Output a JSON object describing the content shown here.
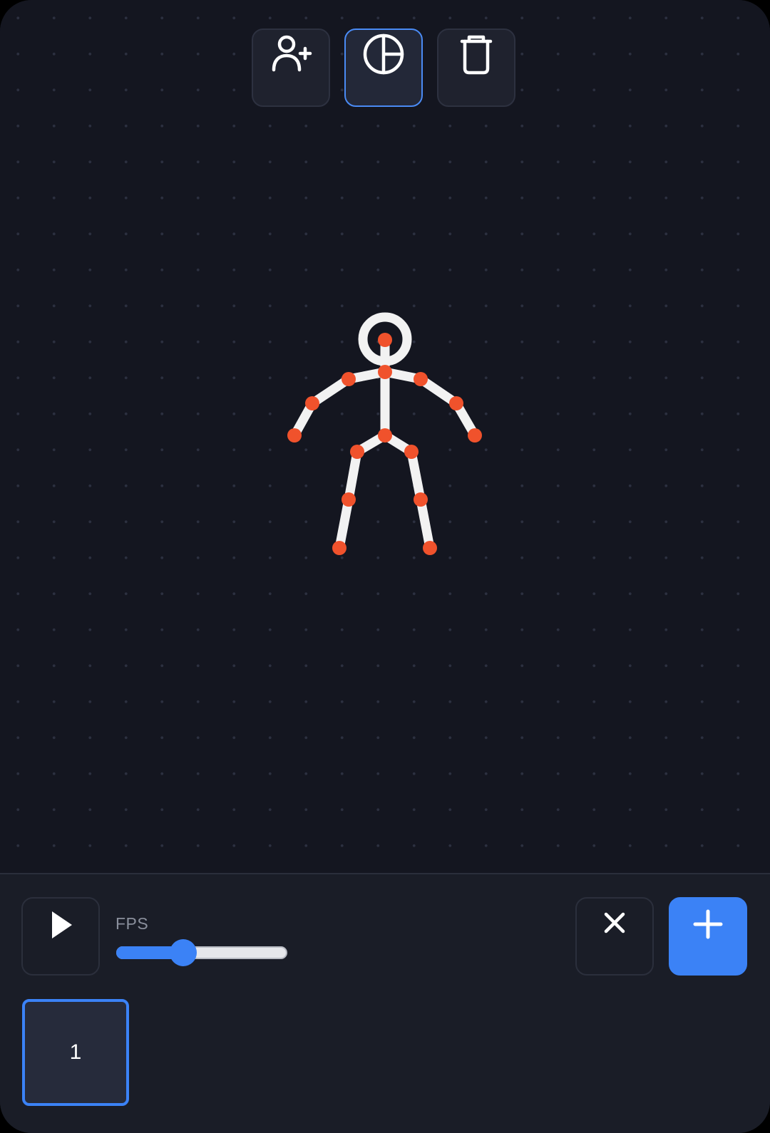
{
  "toolbar": {
    "tools": [
      {
        "id": "add-figure",
        "icon": "user-plus-icon"
      },
      {
        "id": "pose-mode",
        "icon": "circle-quarter-icon",
        "active": true
      },
      {
        "id": "delete",
        "icon": "trash-icon"
      }
    ]
  },
  "timeline": {
    "play_icon": "play-icon",
    "fps_label": "FPS",
    "fps_fraction": 0.39,
    "clear_icon": "close-icon",
    "add_icon": "plus-icon",
    "frames": [
      {
        "label": "1",
        "selected": true
      }
    ]
  },
  "colors": {
    "accent": "#3b82f6",
    "joint": "#f0522c",
    "bone": "#f2f2f2",
    "canvas_bg": "#141620",
    "panel_bg": "#1a1d27"
  }
}
